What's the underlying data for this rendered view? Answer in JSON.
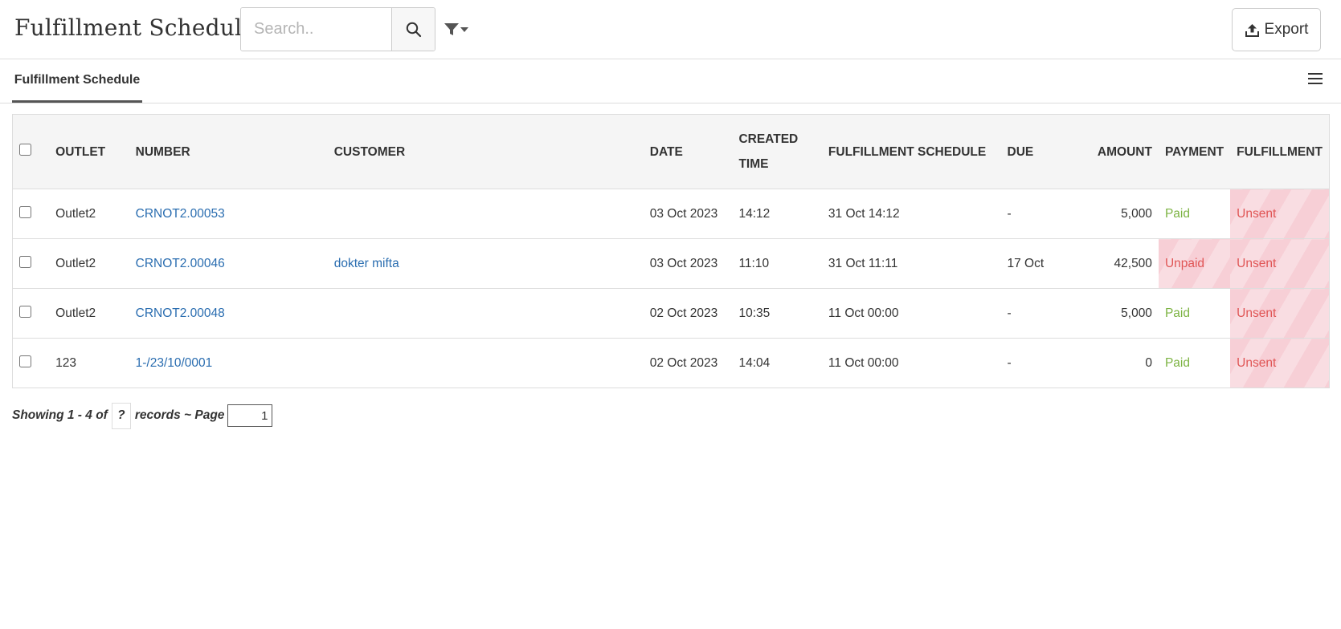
{
  "header": {
    "title": "Fulfillment Schedule",
    "search_placeholder": "Search..",
    "export_label": "Export"
  },
  "tabs": [
    {
      "label": "Fulfillment Schedule",
      "active": true
    }
  ],
  "table": {
    "columns": {
      "outlet": "OUTLET",
      "number": "NUMBER",
      "customer": "CUSTOMER",
      "date": "DATE",
      "created_time_1": "CREATED",
      "created_time_2": "TIME",
      "fulfillment_schedule": "FULFILLMENT SCHEDULE",
      "due": "DUE",
      "amount": "AMOUNT",
      "payment": "PAYMENT",
      "fulfillment": "FULFILLMENT"
    },
    "rows": [
      {
        "outlet": "Outlet2",
        "number": "CRNOT2.00053",
        "customer": "",
        "date": "03 Oct 2023",
        "created_time": "14:12",
        "schedule": "31 Oct 14:12",
        "due": "-",
        "amount": "5,000",
        "payment": "Paid",
        "fulfillment": "Unsent"
      },
      {
        "outlet": "Outlet2",
        "number": "CRNOT2.00046",
        "customer": "dokter mifta",
        "date": "03 Oct 2023",
        "created_time": "11:10",
        "schedule": "31 Oct 11:11",
        "due": "17 Oct",
        "amount": "42,500",
        "payment": "Unpaid",
        "fulfillment": "Unsent"
      },
      {
        "outlet": "Outlet2",
        "number": "CRNOT2.00048",
        "customer": "",
        "date": "02 Oct 2023",
        "created_time": "10:35",
        "schedule": "11 Oct 00:00",
        "due": "-",
        "amount": "5,000",
        "payment": "Paid",
        "fulfillment": "Unsent"
      },
      {
        "outlet": "123",
        "number": "1-/23/10/0001",
        "customer": "",
        "date": "02 Oct 2023",
        "created_time": "14:04",
        "schedule": "11 Oct 00:00",
        "due": "-",
        "amount": "0",
        "payment": "Paid",
        "fulfillment": "Unsent"
      }
    ]
  },
  "pager": {
    "showing": "Showing 1 - 4 of",
    "total": "?",
    "records_page": "records ~ Page",
    "page": "1"
  },
  "colors": {
    "link": "#2a6db0",
    "paid": "#7cb342",
    "unpaid": "#e05555",
    "unsent_bg": "#f7cfd6"
  }
}
